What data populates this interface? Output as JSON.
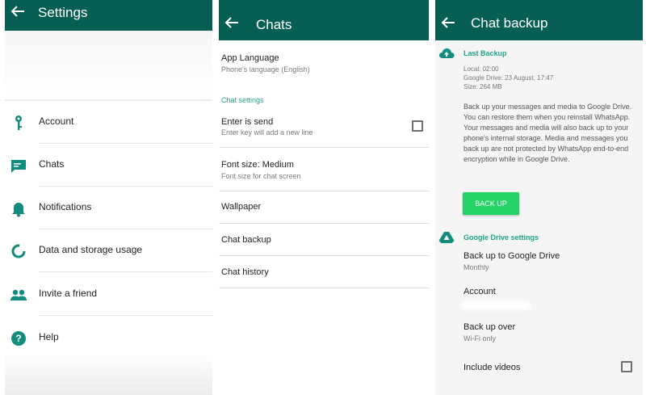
{
  "settings_screen": {
    "title": "Settings",
    "items": [
      {
        "label": "Account",
        "icon": "key-icon"
      },
      {
        "label": "Chats",
        "icon": "chat-icon"
      },
      {
        "label": "Notifications",
        "icon": "bell-icon"
      },
      {
        "label": "Data and storage usage",
        "icon": "data-usage-icon"
      },
      {
        "label": "Invite a friend",
        "icon": "people-icon"
      },
      {
        "label": "Help",
        "icon": "help-icon"
      }
    ]
  },
  "chats_screen": {
    "title": "Chats",
    "app_language": {
      "title": "App Language",
      "subtitle": "Phone's language (English)"
    },
    "section_header": "Chat settings",
    "enter_is_send": {
      "title": "Enter is send",
      "subtitle": "Enter key will add a new line",
      "checked": false
    },
    "font_size": {
      "title": "Font size: Medium",
      "subtitle": "Font size for chat screen"
    },
    "wallpaper": "Wallpaper",
    "chat_backup": "Chat backup",
    "chat_history": "Chat history"
  },
  "backup_screen": {
    "title": "Chat backup",
    "last_backup": {
      "header": "Last Backup",
      "local": "Local: 02:00",
      "google_drive": "Google Drive: 23 August, 17:47",
      "size": "Size: 264 MB"
    },
    "description": "Back up your messages and media to Google Drive. You can restore them when you reinstall WhatsApp. Your messages and media will also back up to your phone's internal storage. Media and messages you back up are not protected by WhatsApp end-to-end encryption while in Google Drive.",
    "back_up_button": "BACK UP",
    "drive_settings_header": "Google Drive settings",
    "back_up_to_drive": {
      "title": "Back up to Google Drive",
      "subtitle": "Monthly"
    },
    "account": {
      "title": "Account"
    },
    "back_up_over": {
      "title": "Back up over",
      "subtitle": "Wi-Fi only"
    },
    "include_videos": {
      "title": "Include videos",
      "checked": false
    }
  },
  "colors": {
    "app_bar": "#075e54",
    "accent_teal": "#1fa38a",
    "button_green": "#25d366",
    "icon_teal": "#128c7e"
  }
}
